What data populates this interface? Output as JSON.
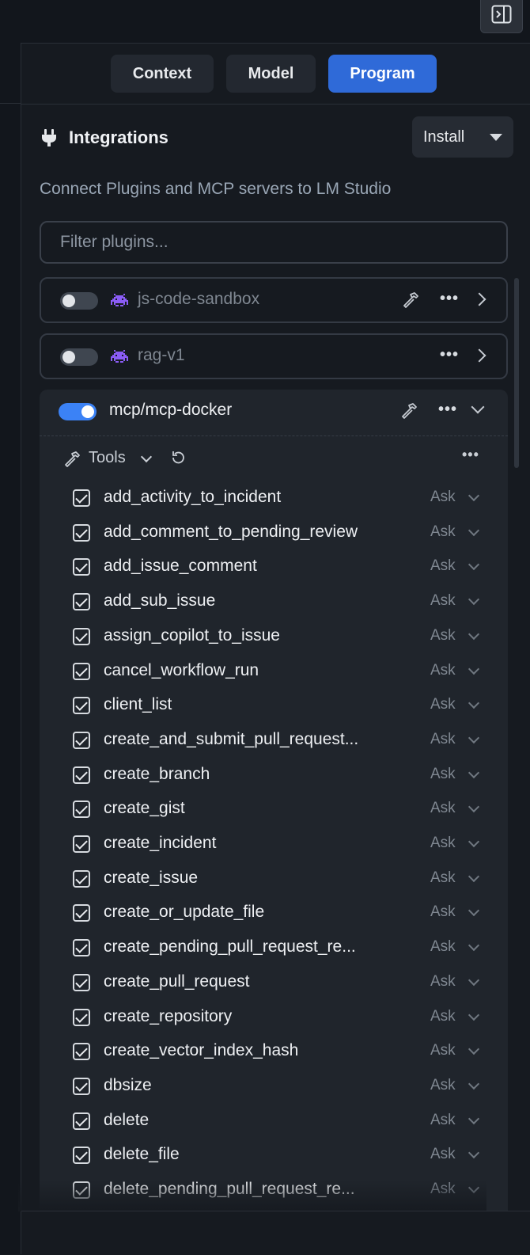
{
  "tabs": {
    "context": "Context",
    "model": "Model",
    "program": "Program",
    "active": "Program"
  },
  "integrations": {
    "title": "Integrations",
    "install_label": "Install",
    "subtitle": "Connect Plugins and MCP servers to LM Studio",
    "filter_placeholder": "Filter plugins..."
  },
  "plugins": [
    {
      "name": "js-code-sandbox",
      "enabled": false,
      "icon": "space-invader-icon",
      "has_tools_icon": true
    },
    {
      "name": "rag-v1",
      "enabled": false,
      "icon": "space-invader-icon",
      "has_tools_icon": false
    },
    {
      "name": "mcp/mcp-docker",
      "enabled": true,
      "expanded": true,
      "has_tools_icon": true
    }
  ],
  "tools_section": {
    "label": "Tools",
    "tools": [
      {
        "name": "add_activity_to_incident",
        "perm": "Ask",
        "checked": true
      },
      {
        "name": "add_comment_to_pending_review",
        "perm": "Ask",
        "checked": true
      },
      {
        "name": "add_issue_comment",
        "perm": "Ask",
        "checked": true
      },
      {
        "name": "add_sub_issue",
        "perm": "Ask",
        "checked": true
      },
      {
        "name": "assign_copilot_to_issue",
        "perm": "Ask",
        "checked": true
      },
      {
        "name": "cancel_workflow_run",
        "perm": "Ask",
        "checked": true
      },
      {
        "name": "client_list",
        "perm": "Ask",
        "checked": true
      },
      {
        "name": "create_and_submit_pull_request...",
        "perm": "Ask",
        "checked": true
      },
      {
        "name": "create_branch",
        "perm": "Ask",
        "checked": true
      },
      {
        "name": "create_gist",
        "perm": "Ask",
        "checked": true
      },
      {
        "name": "create_incident",
        "perm": "Ask",
        "checked": true
      },
      {
        "name": "create_issue",
        "perm": "Ask",
        "checked": true
      },
      {
        "name": "create_or_update_file",
        "perm": "Ask",
        "checked": true
      },
      {
        "name": "create_pending_pull_request_re...",
        "perm": "Ask",
        "checked": true
      },
      {
        "name": "create_pull_request",
        "perm": "Ask",
        "checked": true
      },
      {
        "name": "create_repository",
        "perm": "Ask",
        "checked": true
      },
      {
        "name": "create_vector_index_hash",
        "perm": "Ask",
        "checked": true
      },
      {
        "name": "dbsize",
        "perm": "Ask",
        "checked": true
      },
      {
        "name": "delete",
        "perm": "Ask",
        "checked": true
      },
      {
        "name": "delete_file",
        "perm": "Ask",
        "checked": true
      },
      {
        "name": "delete_pending_pull_request_re...",
        "perm": "Ask",
        "checked": true
      }
    ]
  },
  "colors": {
    "accent": "#2f6ad8",
    "toggle_on": "#3b82f6",
    "plugin_icon": "#8b5cf6"
  }
}
